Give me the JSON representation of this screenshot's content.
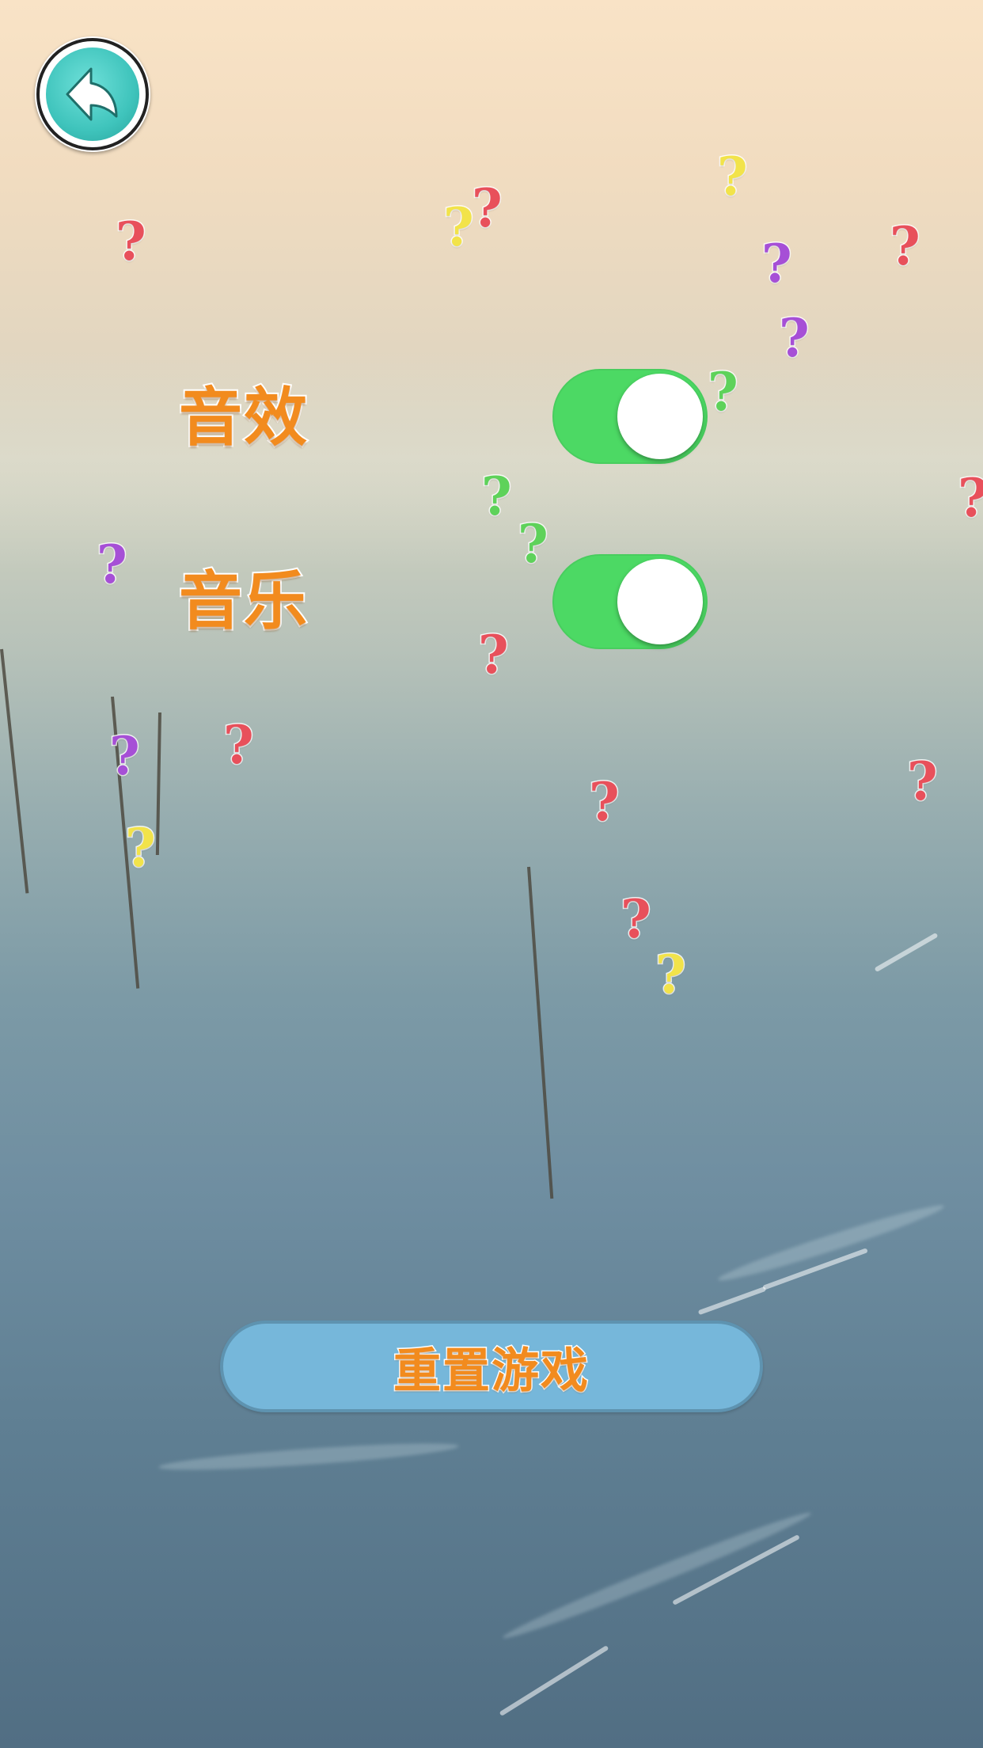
{
  "header": {
    "back_icon": "back-arrow-icon"
  },
  "settings": {
    "sound_effects": {
      "label": "音效",
      "enabled": true
    },
    "music": {
      "label": "音乐",
      "enabled": true
    }
  },
  "actions": {
    "reset_label": "重置游戏"
  },
  "decorations": {
    "question_mark_glyph": "?",
    "question_marks": [
      {
        "color": "#e8505b"
      },
      {
        "color": "#f2e34a"
      },
      {
        "color": "#e8505b"
      },
      {
        "color": "#f2e34a"
      },
      {
        "color": "#a64fd6"
      },
      {
        "color": "#e8505b"
      },
      {
        "color": "#a64fd6"
      },
      {
        "color": "#5ed25a"
      },
      {
        "color": "#e8505b"
      },
      {
        "color": "#5ed25a"
      },
      {
        "color": "#5ed25a"
      },
      {
        "color": "#a64fd6"
      },
      {
        "color": "#e8505b"
      },
      {
        "color": "#a64fd6"
      },
      {
        "color": "#e8505b"
      },
      {
        "color": "#f2e34a"
      },
      {
        "color": "#e8505b"
      },
      {
        "color": "#e8505b"
      },
      {
        "color": "#e8505b"
      },
      {
        "color": "#f2e34a"
      }
    ]
  },
  "colors": {
    "toggle_on": "#4cd964",
    "label_orange": "#f28b1e",
    "reset_button": "#76b7da",
    "back_button_teal": "#3fc4bc"
  }
}
